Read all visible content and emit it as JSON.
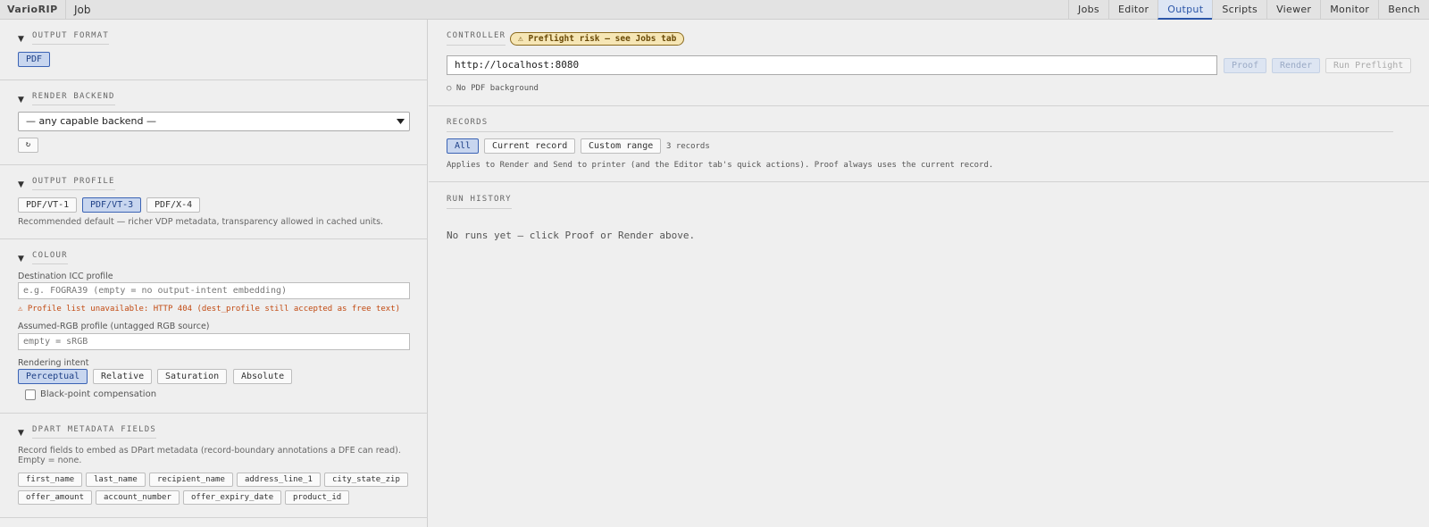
{
  "app": {
    "brand": "VarioRIP",
    "job": "Job"
  },
  "tabs": [
    {
      "label": "Jobs",
      "active": false
    },
    {
      "label": "Editor",
      "active": false
    },
    {
      "label": "Output",
      "active": true
    },
    {
      "label": "Scripts",
      "active": false
    },
    {
      "label": "Viewer",
      "active": false
    },
    {
      "label": "Monitor",
      "active": false
    },
    {
      "label": "Bench",
      "active": false
    }
  ],
  "output_format": {
    "title": "OUTPUT FORMAT",
    "options": [
      "PDF"
    ],
    "selected": "PDF"
  },
  "render_backend": {
    "title": "RENDER BACKEND",
    "value": "— any capable backend —",
    "refresh": "↻"
  },
  "output_profile": {
    "title": "OUTPUT PROFILE",
    "options": [
      "PDF/VT-1",
      "PDF/VT-3",
      "PDF/X-4"
    ],
    "selected": "PDF/VT-3",
    "hint": "Recommended default — richer VDP metadata, transparency allowed in cached units."
  },
  "colour": {
    "title": "COLOUR",
    "dest_label": "Destination ICC profile",
    "dest_placeholder": "e.g. FOGRA39 (empty = no output-intent embedding)",
    "warning": "⚠ Profile list unavailable: HTTP 404 (dest_profile still accepted as free text)",
    "rgb_label": "Assumed-RGB profile (untagged RGB source)",
    "rgb_placeholder": "empty = sRGB",
    "intent_label": "Rendering intent",
    "intents": [
      "Perceptual",
      "Relative",
      "Saturation",
      "Absolute"
    ],
    "intent_selected": "Perceptual",
    "bpc_label": "Black-point compensation",
    "bpc_checked": false
  },
  "dpart": {
    "title": "DPART METADATA FIELDS",
    "hint": "Record fields to embed as DPart metadata (record-boundary annotations a DFE can read). Empty = none.",
    "fields_row1": [
      "first_name",
      "last_name",
      "recipient_name",
      "address_line_1",
      "city_state_zip"
    ],
    "fields_row2": [
      "offer_amount",
      "account_number",
      "offer_expiry_date",
      "product_id"
    ]
  },
  "controller": {
    "title": "CONTROLLER",
    "badge": "⚠ Preflight risk — see Jobs tab",
    "url": "http://localhost:8080",
    "proof": "Proof",
    "render": "Render",
    "preflight": "Run Preflight",
    "bg_note": "○ No PDF background"
  },
  "records": {
    "title": "RECORDS",
    "options": [
      "All",
      "Current record",
      "Custom range"
    ],
    "selected": "All",
    "count": "3 records",
    "note": "Applies to Render and Send to printer (and the Editor tab's quick actions). Proof always uses the current record."
  },
  "history": {
    "title": "RUN HISTORY",
    "empty": "No runs yet — click Proof or Render above."
  },
  "colors": {
    "accent": "#2a55a8",
    "selected_bg": "#c8d6ef",
    "warning": "#c24a12",
    "badge_bg": "#f6e6b5"
  }
}
